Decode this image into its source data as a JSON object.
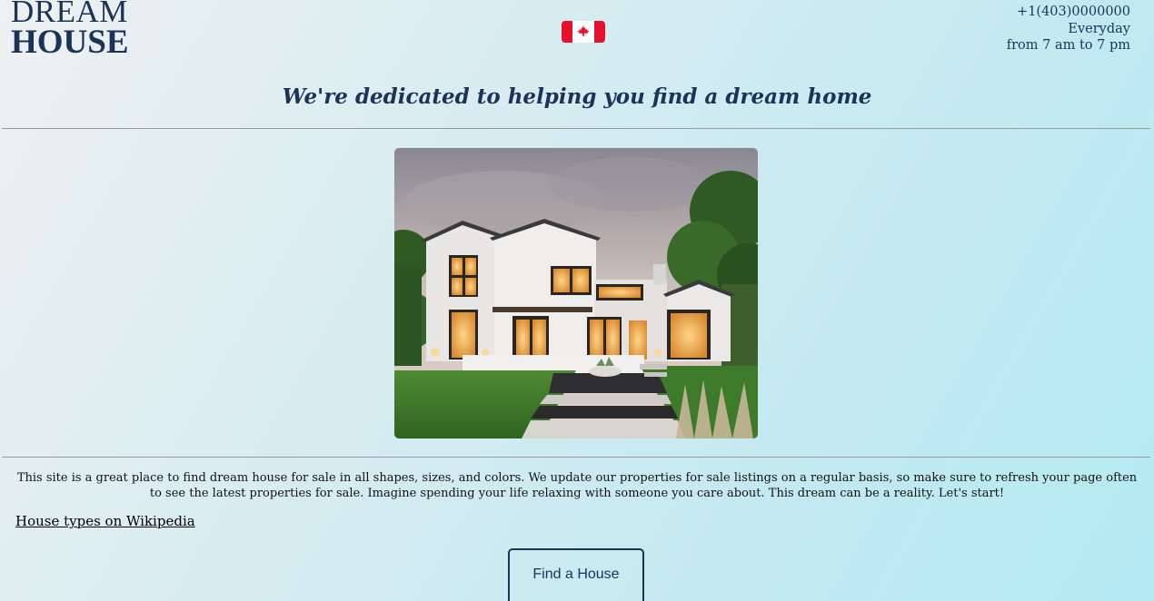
{
  "header": {
    "logo_line1": "DREAM",
    "logo_line2": "HOUSE",
    "flag_icon": "canada-flag-icon",
    "phone": "+1(403)0000000",
    "days": "Everyday",
    "hours": "from 7 am to 7 pm"
  },
  "tagline": "We're dedicated to helping you find a dream home",
  "hero": {
    "image_icon": "modern-house-photo"
  },
  "main": {
    "description": "This site is a great place to find dream house for sale in all shapes, sizes, and colors. We update our properties for sale listings on a regular basis, so make sure to refresh your page often to see the latest properties for sale. Imagine spending your life relaxing with someone you care about. This dream can be a reality. Let's start!",
    "wiki_link": "House types on Wikipedia",
    "find_button": "Find a House"
  },
  "colors": {
    "brand": "#1b3358",
    "flag_red": "#e8112d"
  }
}
